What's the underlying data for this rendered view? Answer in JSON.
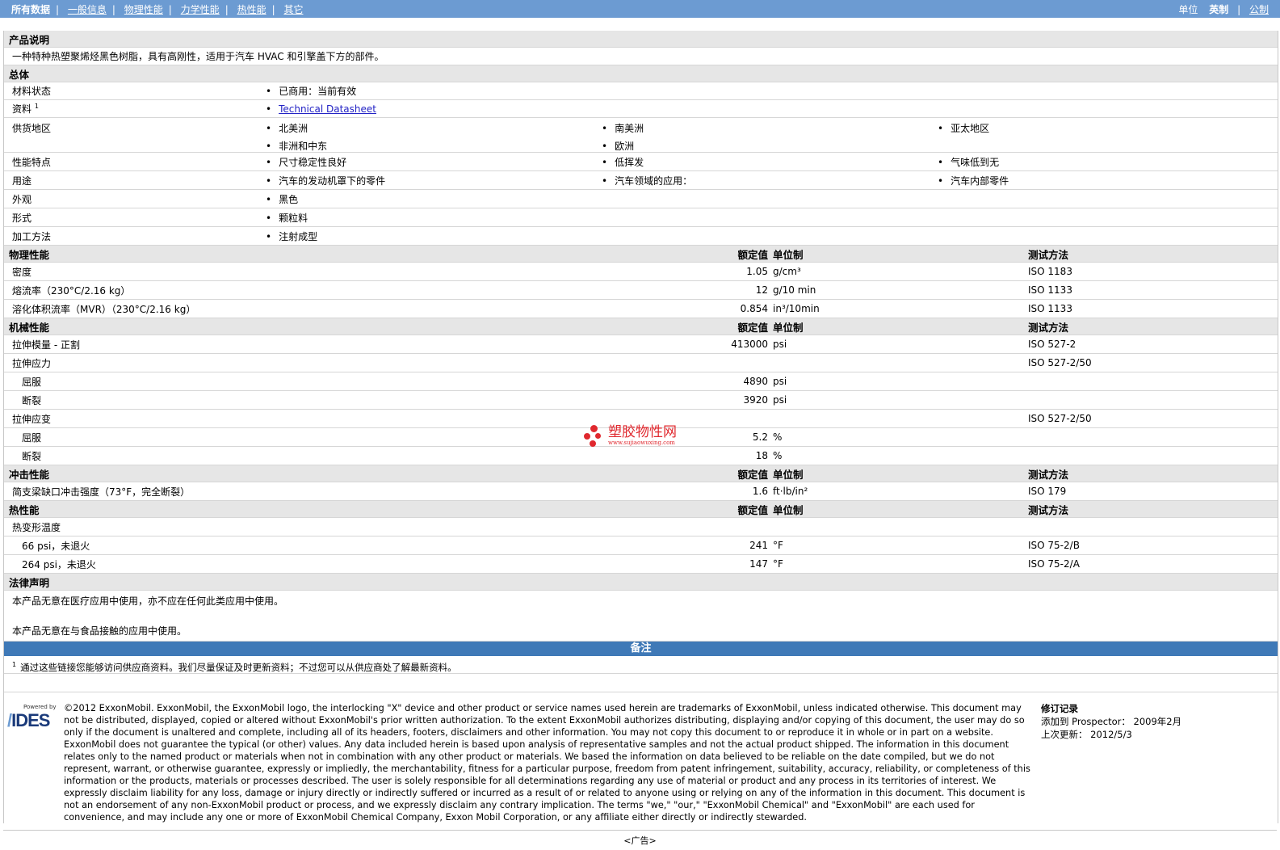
{
  "topbar": {
    "tabs": [
      "所有数据",
      "一般信息",
      "物理性能",
      "力学性能",
      "热性能",
      "其它"
    ],
    "unit_label": "单位",
    "unit_active": "英制",
    "unit_other": "公制"
  },
  "product": {
    "header": "产品说明",
    "description": "一种特种热塑聚烯烃黑色树脂，具有高刚性，适用于汽车 HVAC 和引擎盖下方的部件。"
  },
  "general": {
    "header": "总体",
    "material_status": {
      "label": "材料状态",
      "value": "已商用：当前有效"
    },
    "sources": {
      "label": "资料",
      "sup": "1",
      "value": "Technical Datasheet"
    },
    "availability": {
      "label": "供货地区",
      "values": [
        "北美洲",
        "南美洲",
        "亚太地区",
        "非洲和中东",
        "欧洲"
      ]
    },
    "features": {
      "label": "性能特点",
      "values": [
        "尺寸稳定性良好",
        "低挥发",
        "气味低到无"
      ]
    },
    "uses": {
      "label": "用途",
      "values": [
        "汽车的发动机罩下的零件",
        "汽车领域的应用：",
        "汽车内部零件"
      ]
    },
    "appearance": {
      "label": "外观",
      "value": "黑色"
    },
    "form": {
      "label": "形式",
      "value": "颗粒料"
    },
    "processing": {
      "label": "加工方法",
      "value": "注射成型"
    }
  },
  "columns": {
    "value": "额定值",
    "unit": "单位制",
    "test": "测试方法"
  },
  "physical": {
    "header": "物理性能",
    "rows": [
      {
        "name": "密度",
        "value": "1.05",
        "unit": "g/cm³",
        "test": "ISO 1183"
      },
      {
        "name": "熔流率（230°C/2.16 kg）",
        "value": "12",
        "unit": "g/10 min",
        "test": "ISO 1133"
      },
      {
        "name": "溶化体积流率（MVR）（230°C/2.16 kg）",
        "value": "0.854",
        "unit": "in³/10min",
        "test": "ISO 1133"
      }
    ]
  },
  "mechanical": {
    "header": "机械性能",
    "tensile_modulus": {
      "name": "拉伸模量 - 正割",
      "value": "413000",
      "unit": "psi",
      "test": "ISO 527-2"
    },
    "tensile_stress": {
      "name": "拉伸应力",
      "test": "ISO 527-2/50"
    },
    "stress_yield": {
      "name": "屈服",
      "value": "4890",
      "unit": "psi"
    },
    "stress_break": {
      "name": "断裂",
      "value": "3920",
      "unit": "psi"
    },
    "tensile_strain": {
      "name": "拉伸应变",
      "test": "ISO 527-2/50"
    },
    "strain_yield": {
      "name": "屈服",
      "value": "5.2",
      "unit": "%"
    },
    "strain_break": {
      "name": "断裂",
      "value": "18",
      "unit": "%"
    }
  },
  "impact": {
    "header": "冲击性能",
    "charpy": {
      "name": "简支梁缺口冲击强度（73°F，完全断裂）",
      "value": "1.6",
      "unit": "ft·lb/in²",
      "test": "ISO 179"
    }
  },
  "thermal": {
    "header": "热性能",
    "hdt": {
      "name": "热变形温度"
    },
    "hdt66": {
      "name": "66 psi，未退火",
      "value": "241",
      "unit": "°F",
      "test": "ISO 75-2/B"
    },
    "hdt264": {
      "name": "264 psi，未退火",
      "value": "147",
      "unit": "°F",
      "test": "ISO 75-2/A"
    }
  },
  "legal": {
    "header": "法律声明",
    "line1": "本产品无意在医疗应用中使用，亦不应在任何此类应用中使用。",
    "line2": "本产品无意在与食品接触的应用中使用。"
  },
  "notes": {
    "header": "备注",
    "sup": "1",
    "text": "通过这些链接您能够访问供应商资料。我们尽量保证及时更新资料；不过您可以从供应商处了解最新资料。"
  },
  "footer": {
    "powered_by": "Powered by",
    "logo": "IDES",
    "disclaimer": "©2012 ExxonMobil. ExxonMobil, the ExxonMobil logo, the interlocking \"X\" device and other product or service names used herein are trademarks of ExxonMobil, unless indicated otherwise. This document may not be distributed, displayed, copied or altered without ExxonMobil's prior written authorization. To the extent ExxonMobil authorizes distributing, displaying and/or copying of this document, the user may do so only if the document is unaltered and complete, including all of its headers, footers, disclaimers and other information. You may not copy this document to or reproduce it in whole or in part on a website. ExxonMobil does not guarantee the typical (or other) values. Any data included herein is based upon analysis of representative samples and not the actual product shipped. The information in this document relates only to the named product or materials when not in combination with any other product or materials. We based the information on data believed to be reliable on the date compiled, but we do not represent, warrant, or otherwise guarantee, expressly or impliedly, the merchantability, fitness for a particular purpose, freedom from patent infringement, suitability, accuracy, reliability, or completeness of this information or the products, materials or processes described. The user is solely responsible for all determinations regarding any use of material or product and any process in its territories of interest. We expressly disclaim liability for any loss, damage or injury directly or indirectly suffered or incurred as a result of or related to anyone using or relying on any of the information in this document. This document is not an endorsement of any non-ExxonMobil product or process, and we expressly disclaim any contrary implication. The terms \"we,\" \"our,\" \"ExxonMobil Chemical\" and \"ExxonMobil\" are each used for convenience, and may include any one or more of ExxonMobil Chemical Company, Exxon Mobil Corporation, or any affiliate either directly or indirectly stewarded.",
    "revision_title": "修订记录",
    "added_label": "添加到 Prospector：",
    "added_value": "2009年2月",
    "updated_label": "上次更新：",
    "updated_value": "2012/5/3",
    "ad": "<广告>"
  },
  "watermark": {
    "cn": "塑胶物性网",
    "url": "www.sujiaowuxing.com"
  }
}
